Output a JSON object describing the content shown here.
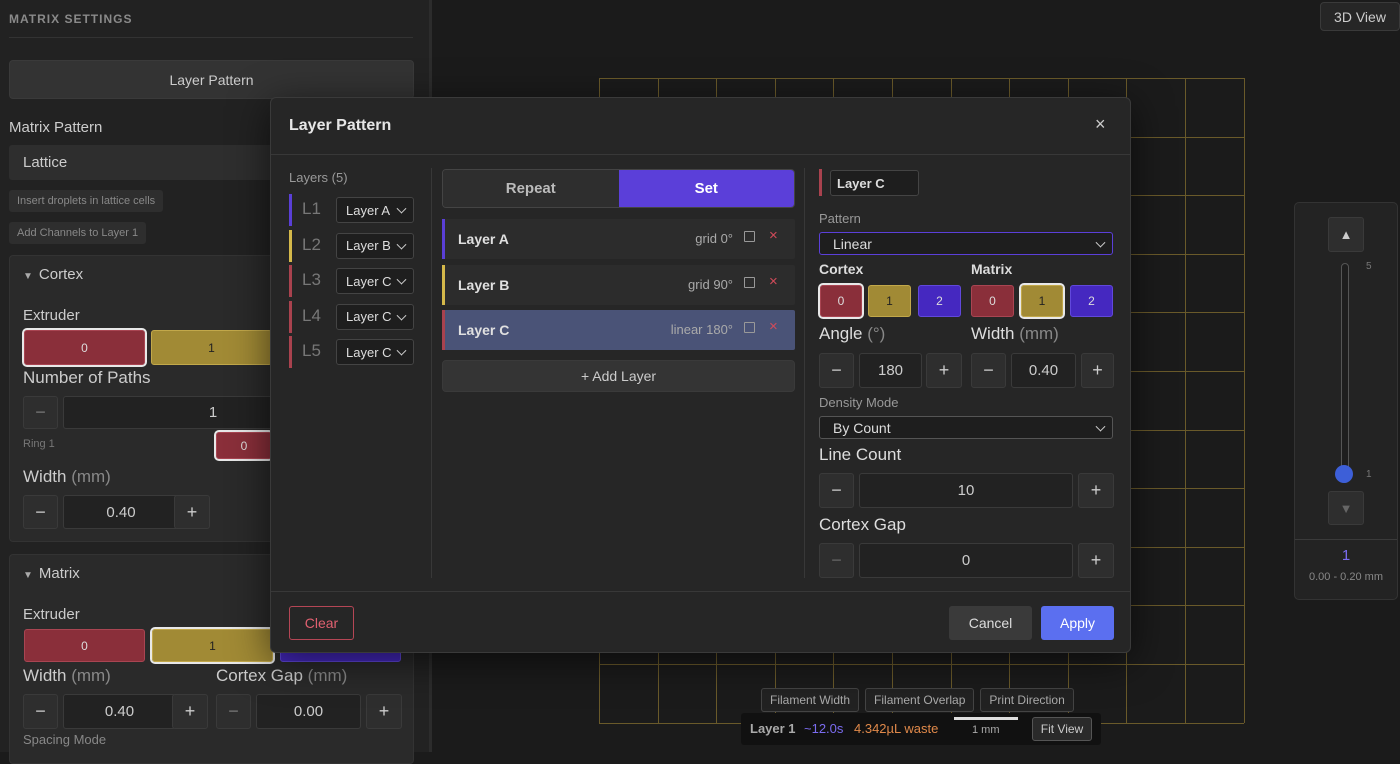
{
  "left": {
    "section_title": "MATRIX SETTINGS",
    "layer_pattern_btn": "Layer Pattern",
    "matrix_pattern_label": "Matrix Pattern",
    "matrix_pattern_value": "Lattice",
    "chip_insert": "Insert droplets in lattice cells",
    "chip_add_channels": "Add Channels to Layer 1",
    "cortex": {
      "title": "Cortex",
      "extruder_label": "Extruder",
      "extruders": [
        "0",
        "1"
      ],
      "paths_label": "Number of Paths",
      "paths_value": "1",
      "ring_label": "Ring 1",
      "ring_extruder": "0",
      "width_label": "Width",
      "width_unit": "(mm)",
      "width_value": "0.40"
    },
    "matrix": {
      "title": "Matrix",
      "extruder_label": "Extruder",
      "extruders": [
        "0",
        "1"
      ],
      "width_label": "Width",
      "width_unit": "(mm)",
      "width_value": "0.40",
      "gap_label": "Cortex Gap",
      "gap_unit": "(mm)",
      "gap_value": "0.00",
      "spacing_label": "Spacing Mode"
    }
  },
  "canvas": {
    "view_btn": "3D View",
    "slider_value": "1",
    "slider_range": "0.00 - 0.20 mm",
    "slider_top_tick": "5",
    "slider_bottom_tick": "1",
    "toggles": [
      "Filament Width",
      "Filament Overlap",
      "Print Direction"
    ],
    "status": {
      "layer": "Layer 1",
      "time": "~12.0s",
      "waste": "4.342µL waste",
      "scale": "1 mm",
      "fit_btn": "Fit View"
    }
  },
  "modal": {
    "title": "Layer Pattern",
    "close": "×",
    "layers_header": "Layers (5)",
    "layers": [
      {
        "id": "L1",
        "value": "Layer A",
        "color": "#5a3fd6"
      },
      {
        "id": "L2",
        "value": "Layer B",
        "color": "#d4b84a"
      },
      {
        "id": "L3",
        "value": "Layer C",
        "color": "#a9424e"
      },
      {
        "id": "L4",
        "value": "Layer C",
        "color": "#a9424e"
      },
      {
        "id": "L5",
        "value": "Layer C",
        "color": "#a9424e"
      }
    ],
    "mode_tabs": [
      "Repeat",
      "Set"
    ],
    "active_tab": "Set",
    "defs": [
      {
        "name": "Layer A",
        "desc": "grid 0°",
        "color": "#5a3fd6"
      },
      {
        "name": "Layer B",
        "desc": "grid 90°",
        "color": "#d4b84a"
      },
      {
        "name": "Layer C",
        "desc": "linear 180°",
        "color": "#a9424e"
      }
    ],
    "add_layer": "+ Add Layer",
    "editor": {
      "name_value": "Layer C",
      "pattern_label": "Pattern",
      "pattern_value": "Linear",
      "cortex_label": "Cortex",
      "matrix_label": "Matrix",
      "extruders": [
        "0",
        "1",
        "2"
      ],
      "angle_label": "Angle",
      "angle_unit": "(°)",
      "angle_value": "180",
      "width_label": "Width",
      "width_unit": "(mm)",
      "width_value": "0.40",
      "density_label": "Density Mode",
      "density_value": "By Count",
      "line_count_label": "Line Count",
      "line_count_value": "10",
      "cortex_gap_label": "Cortex Gap",
      "cortex_gap_value": "0"
    },
    "footer": {
      "clear": "Clear",
      "cancel": "Cancel",
      "apply": "Apply"
    }
  },
  "colors": {
    "accent": "#5b3fd9",
    "apply": "#5b6ff0",
    "ext0": "#8a2f3a",
    "ext1": "#a18a35",
    "ext2": "#4528c0"
  }
}
